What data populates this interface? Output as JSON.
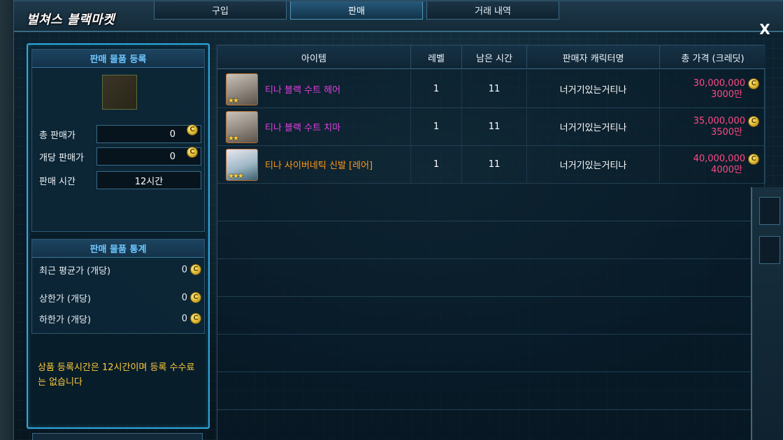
{
  "window": {
    "title": "벌쳐스 블랙마켓",
    "close_glyph": "X"
  },
  "tabs": [
    {
      "label": "구입",
      "active": false
    },
    {
      "label": "판매",
      "active": true
    },
    {
      "label": "거래 내역",
      "active": false
    }
  ],
  "registration": {
    "header": "판매 물품 등록",
    "total_price_label": "총 판매가",
    "total_price_value": "0",
    "unit_price_label": "개당 판매가",
    "unit_price_value": "0",
    "duration_label": "판매 시간",
    "duration_value": "12시간"
  },
  "stats": {
    "header": "판매 물품 통계",
    "rows": [
      {
        "label": "최근 평균가 (개당)",
        "value": "0"
      },
      {
        "label": "상한가 (개당)",
        "value": "0"
      },
      {
        "label": "하한가 (개당)",
        "value": "0"
      }
    ]
  },
  "notice": "상품 등록시간은 12시간이며 등록 수수료는 없습니다",
  "coin_glyph": "C",
  "table": {
    "headers": [
      "아이템",
      "레벨",
      "남은 시간",
      "판매자 캐릭터명",
      "총 가격 (크레딧)"
    ],
    "rows": [
      {
        "icon": "hair-item-icon",
        "name": "티나 블랙 수트 헤어",
        "name_color": "#e040e0",
        "level": "1",
        "remaining": "11",
        "seller": "너거기있는거티나",
        "price": "30,000,000",
        "price_short": "3000만"
      },
      {
        "icon": "skirt-item-icon",
        "name": "티나 블랙 수트 치마",
        "name_color": "#e040e0",
        "level": "1",
        "remaining": "11",
        "seller": "너거기있는거티나",
        "price": "35,000,000",
        "price_short": "3500만"
      },
      {
        "icon": "shoes-item-icon",
        "name": "티나 사이버네틱 신발 [레어]",
        "name_color": "#ff9a1a",
        "level": "1",
        "remaining": "11",
        "seller": "너거기있는거티나",
        "price": "40,000,000",
        "price_short": "4000만"
      }
    ]
  },
  "colors": {
    "accent": "#2fa9df",
    "price": "#ff4a86",
    "notice": "#ffcb3a",
    "header_text": "#6ec8ff"
  }
}
